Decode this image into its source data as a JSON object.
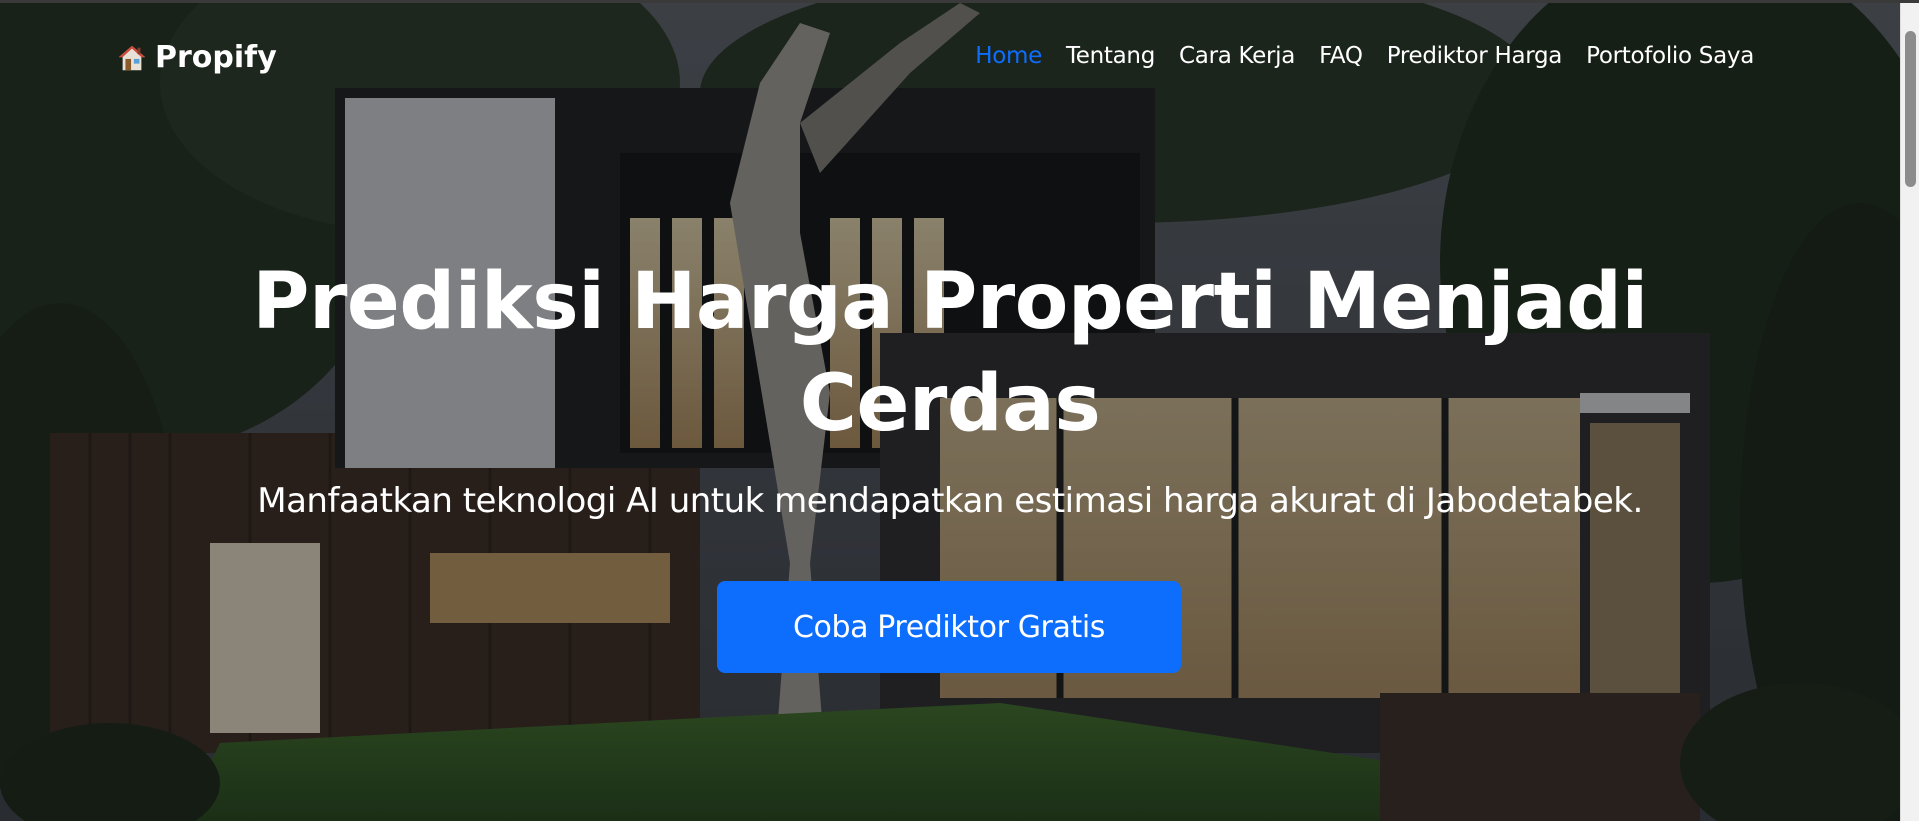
{
  "nav": {
    "brand": "Propify",
    "brand_icon": "house-icon",
    "links": [
      {
        "label": "Home",
        "active": true
      },
      {
        "label": "Tentang",
        "active": false
      },
      {
        "label": "Cara Kerja",
        "active": false
      },
      {
        "label": "FAQ",
        "active": false
      },
      {
        "label": "Prediktor Harga",
        "active": false
      },
      {
        "label": "Portofolio Saya",
        "active": false
      }
    ]
  },
  "hero": {
    "title": "Prediksi Harga Properti Menjadi Cerdas",
    "subtitle": "Manfaatkan teknologi AI untuk mendapatkan estimasi harga akurat di Jabodetabek.",
    "cta_label": "Coba Prediktor Gratis",
    "background": "modern-house-at-dusk-image"
  },
  "colors": {
    "accent": "#0d6efd",
    "text": "#ffffff"
  }
}
